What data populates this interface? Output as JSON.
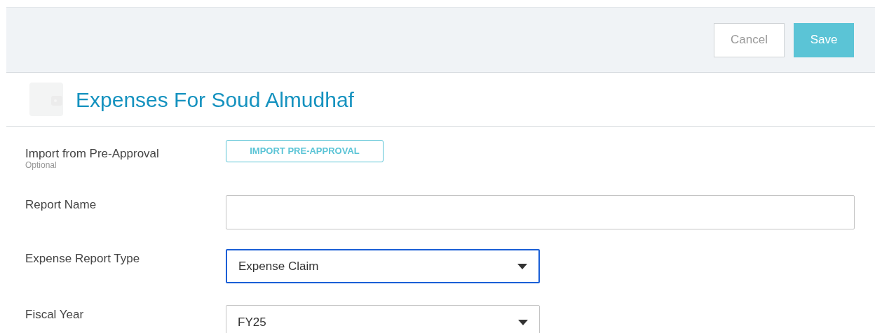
{
  "toolbar": {
    "buttons": [
      {
        "label": "Cancel",
        "kind": "secondary"
      },
      {
        "label": "Save",
        "kind": "primary"
      }
    ]
  },
  "title": "Expenses For Soud Almudhaf",
  "fields": [
    {
      "label": "Import from Pre-Approval",
      "hint": "Optional",
      "kind": "button",
      "button": "IMPORT PRE-APPROVAL"
    },
    {
      "label": "Report Name",
      "kind": "text",
      "focused": false
    },
    {
      "label": "Expense Report Type",
      "kind": "select",
      "value": "Expense Claim",
      "focused": true
    },
    {
      "label": "Fiscal Year",
      "kind": "select",
      "value": "FY25",
      "focused": false
    }
  ]
}
